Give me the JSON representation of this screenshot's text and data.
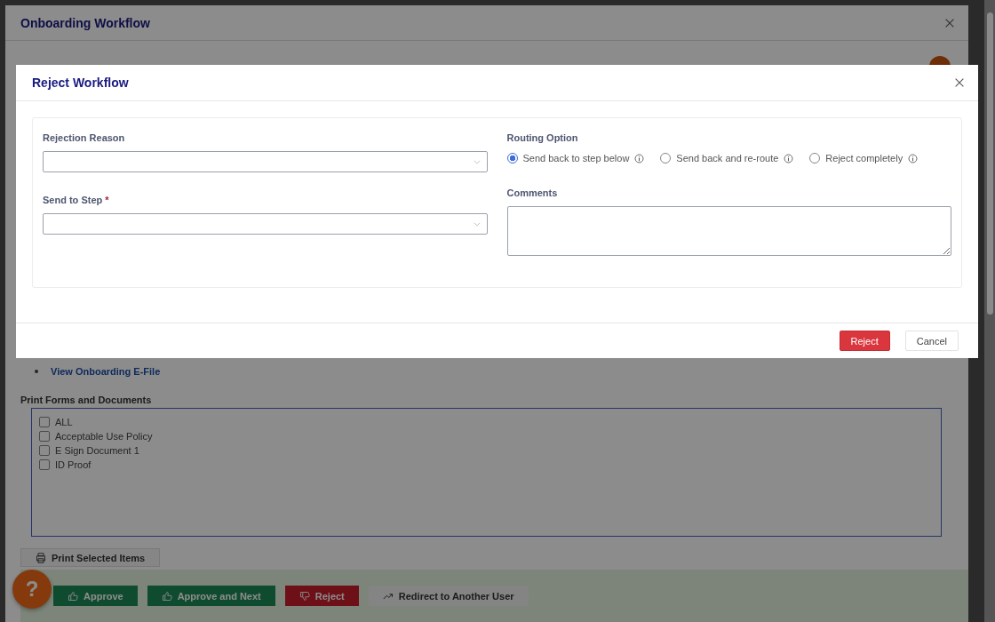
{
  "background_dialog": {
    "title": "Onboarding Workflow",
    "links": [
      "View Onboarding E-File"
    ],
    "print_section": {
      "title": "Print Forms and Documents",
      "items": [
        {
          "label": "ALL",
          "checked": false
        },
        {
          "label": "Acceptable Use Policy",
          "checked": false
        },
        {
          "label": "E Sign Document 1",
          "checked": false
        },
        {
          "label": "ID Proof",
          "checked": false
        }
      ],
      "button": "Print Selected Items"
    },
    "actions": [
      {
        "label": "Approve",
        "kind": "approve"
      },
      {
        "label": "Approve and Next",
        "kind": "approve"
      },
      {
        "label": "Reject",
        "kind": "reject"
      },
      {
        "label": "Redirect to Another User",
        "kind": "redirect"
      }
    ],
    "help": "?"
  },
  "modal": {
    "title": "Reject Workflow",
    "fields": [
      {
        "label": "Rejection Reason"
      },
      {
        "label": "Send to Step",
        "required_mark": "*"
      }
    ],
    "routing": {
      "label": "Routing Option",
      "options": [
        {
          "label": "Send back to step below",
          "selected": true
        },
        {
          "label": "Send back and re-route",
          "selected": false
        },
        {
          "label": "Reject completely",
          "selected": false
        }
      ]
    },
    "comments": {
      "label": "Comments"
    },
    "buttons": [
      {
        "label": "Reject",
        "kind": "primary"
      },
      {
        "label": "Cancel",
        "kind": "secondary"
      }
    ]
  }
}
